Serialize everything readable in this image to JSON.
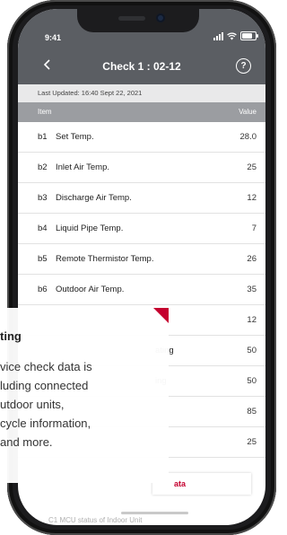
{
  "status_bar": {
    "time": "9:41"
  },
  "header": {
    "title": "Check 1 : 02-12",
    "back_icon": "chevron-left-icon",
    "help_icon": "?"
  },
  "last_updated": "Last Updated: 16:40 Sept 22, 2021",
  "table": {
    "columns": [
      "Item",
      "Value"
    ],
    "rows": [
      {
        "code": "b1",
        "label": "Set Temp.",
        "value": "28.0"
      },
      {
        "code": "b2",
        "label": "Inlet Air Temp.",
        "value": "25"
      },
      {
        "code": "b3",
        "label": "Discharge Air Temp.",
        "value": "12"
      },
      {
        "code": "b4",
        "label": "Liquid Pipe Temp.",
        "value": "7"
      },
      {
        "code": "b5",
        "label": "Remote Thermistor Temp.",
        "value": "26"
      },
      {
        "code": "b6",
        "label": "Outdoor Air Temp.",
        "value": "35"
      },
      {
        "code": "",
        "label": "",
        "value": "12"
      },
      {
        "code": "",
        "label": "ating",
        "value": "50"
      },
      {
        "code": "",
        "label": "ing",
        "value": "50"
      },
      {
        "code": "",
        "label": "",
        "value": "85"
      },
      {
        "code": "",
        "label": "",
        "value": "25"
      }
    ]
  },
  "show_data_button": "ata",
  "bottom_text": "C1  MCU status of Indoor Unit",
  "overlay": {
    "title": "ting",
    "body_lines": [
      "vice check data is",
      "luding connected",
      "utdoor units,",
      "cycle information,",
      "and more."
    ]
  },
  "colors": {
    "header_bg": "#5b5e63",
    "accent": "#c5002f",
    "table_head_bg": "#9b9da1"
  }
}
